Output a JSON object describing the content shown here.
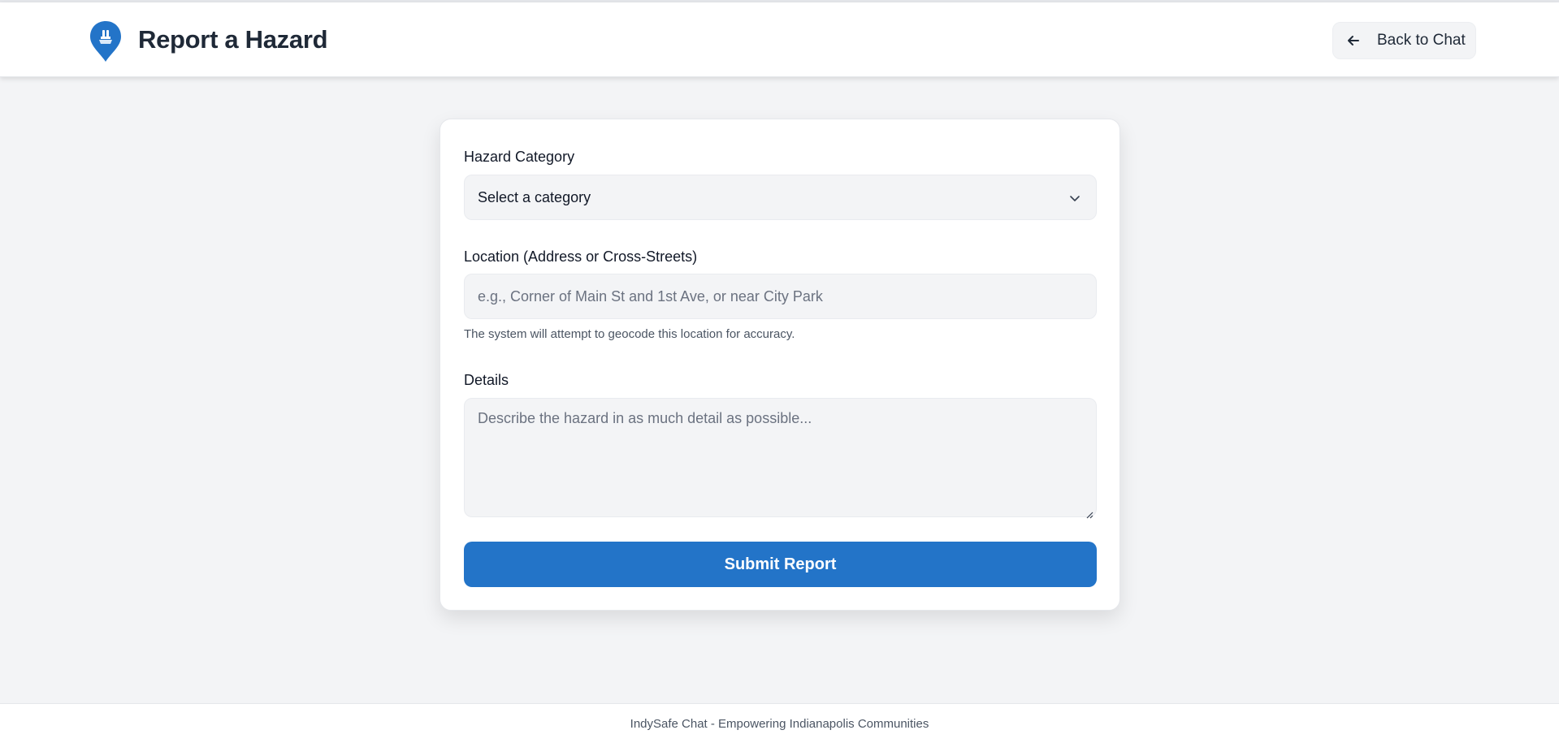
{
  "header": {
    "title": "Report a Hazard",
    "back_label": "Back to Chat",
    "logo_icon": "map-pin-shield-icon",
    "brand_color": "#2374c8"
  },
  "form": {
    "category_label": "Hazard Category",
    "category_selected": "Select a category",
    "location_label": "Location (Address or Cross-Streets)",
    "location_placeholder": "e.g., Corner of Main St and 1st Ave, or near City Park",
    "location_hint": "The system will attempt to geocode this location for accuracy.",
    "details_label": "Details",
    "details_placeholder": "Describe the hazard in as much detail as possible...",
    "submit_label": "Submit Report"
  },
  "footer": {
    "text": "IndySafe Chat - Empowering Indianapolis Communities"
  }
}
